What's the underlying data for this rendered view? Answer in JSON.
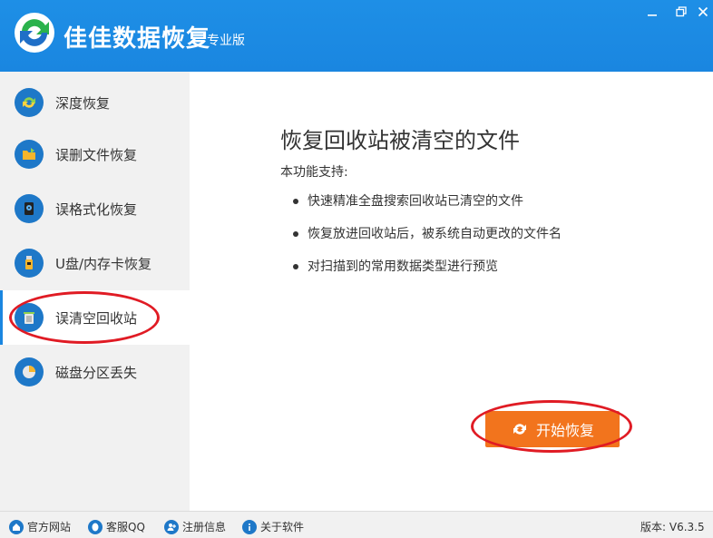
{
  "app": {
    "title": "佳佳数据恢复",
    "edition": "专业版"
  },
  "sidebar": {
    "items": [
      {
        "label": "深度恢复",
        "icon": "refresh-icon"
      },
      {
        "label": "误删文件恢复",
        "icon": "folder-icon"
      },
      {
        "label": "误格式化恢复",
        "icon": "hard-disk-icon"
      },
      {
        "label": "U盘/内存卡恢复",
        "icon": "usb-drive-icon"
      },
      {
        "label": "误清空回收站",
        "icon": "recycle-bin-icon"
      },
      {
        "label": "磁盘分区丢失",
        "icon": "pie-chart-icon"
      }
    ],
    "active_index": 4
  },
  "main": {
    "heading": "恢复回收站被清空的文件",
    "subheading": "本功能支持:",
    "features": [
      "快速精准全盘搜索回收站已清空的文件",
      "恢复放进回收站后，被系统自动更改的文件名",
      "对扫描到的常用数据类型进行预览"
    ],
    "start_button": "开始恢复"
  },
  "statusbar": {
    "links": [
      {
        "label": "官方网站",
        "icon": "home-icon"
      },
      {
        "label": "客服QQ",
        "icon": "qq-icon"
      },
      {
        "label": "注册信息",
        "icon": "add-user-icon"
      },
      {
        "label": "关于软件",
        "icon": "info-icon"
      }
    ],
    "version": "版本: V6.3.5"
  },
  "colors": {
    "title_bar": "#1a86e0",
    "accent": "#f2741d",
    "annotation": "#e01b24"
  }
}
